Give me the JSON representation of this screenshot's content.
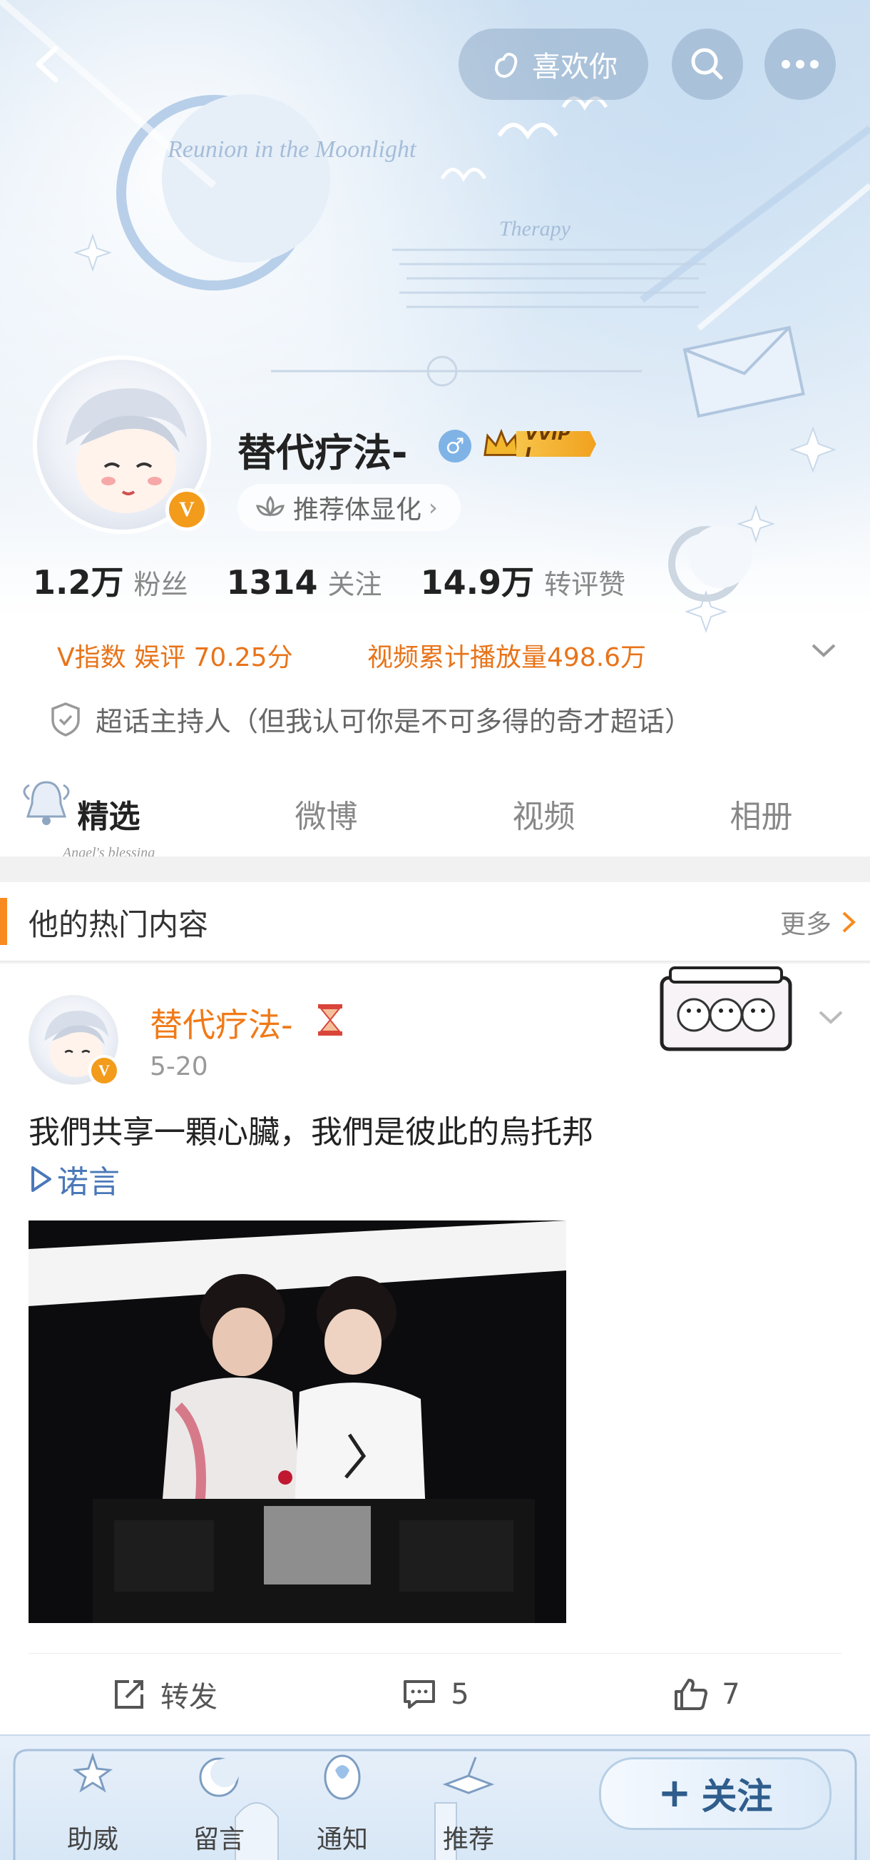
{
  "header": {
    "like_label": "喜欢你",
    "banner_script_title": "Reunion in the Moonlight",
    "banner_script_subtitle": "Therapy"
  },
  "profile": {
    "name": "替代疗法-",
    "vip_label": "VVIP I",
    "recommend_label": "推荐体显化",
    "stats": [
      {
        "num": "1.2万",
        "label": "粉丝"
      },
      {
        "num": "1314",
        "label": "关注"
      },
      {
        "num": "14.9万",
        "label": "转评赞"
      }
    ],
    "v_index": "V指数 娱评 70.25分",
    "video_plays": "视频累计播放量498.6万",
    "supertopic": "超话主持人（但我认可你是不可多得的奇才超话）"
  },
  "tabs": [
    {
      "label": "精选",
      "active": true
    },
    {
      "label": "微博",
      "active": false
    },
    {
      "label": "视频",
      "active": false
    },
    {
      "label": "相册",
      "active": false
    }
  ],
  "tab_script": "Angel's blessing",
  "hot": {
    "title": "他的热门内容",
    "more": "更多"
  },
  "post": {
    "name": "替代疗法-",
    "date": "5-20",
    "text": "我們共享一顆心臟，我們是彼此的烏托邦",
    "link": "诺言",
    "actions": {
      "repost": "转发",
      "comments": "5",
      "likes": "7"
    }
  },
  "bottom_nav": {
    "items": [
      "助威",
      "留言",
      "通知",
      "推荐"
    ],
    "follow": "关注"
  },
  "colors": {
    "accent_orange": "#f07a18",
    "link_blue": "#4a78b8",
    "badge_orange": "#f39b1a"
  }
}
